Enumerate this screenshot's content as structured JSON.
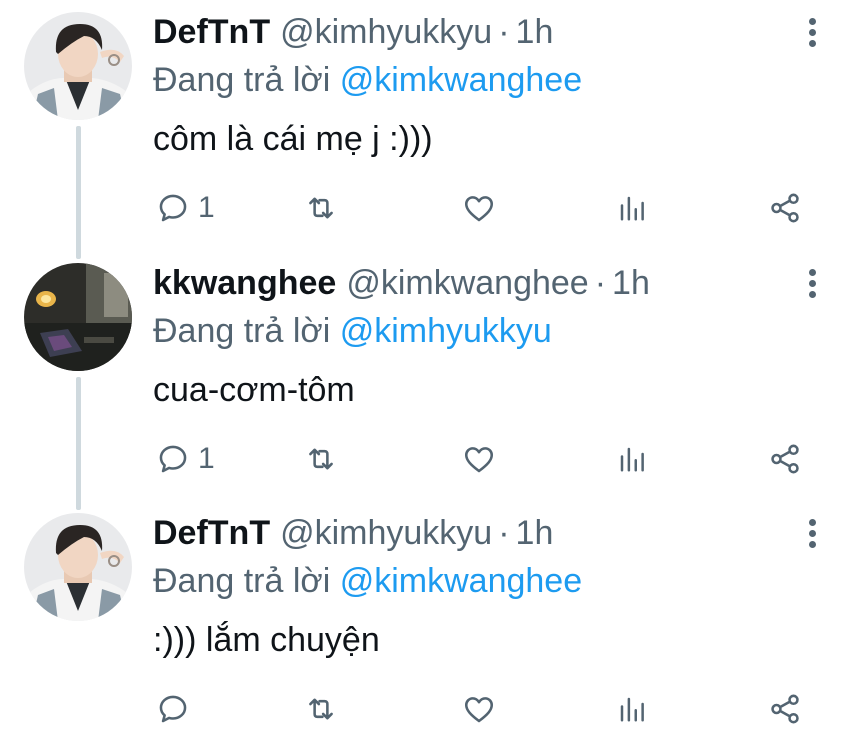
{
  "tweets": [
    {
      "name": "DefTnT",
      "handle": "@kimhyukkyu",
      "separator": "·",
      "time": "1h",
      "reply_prefix": "Đang trả lời",
      "reply_to": "@kimkwanghee",
      "text": "côm là cái mẹ j :)))",
      "reply_count": "1",
      "avatar": "boy-avatar"
    },
    {
      "name": "kkwanghee",
      "handle": "@kimkwanghee",
      "separator": "·",
      "time": "1h",
      "reply_prefix": "Đang trả lời",
      "reply_to": "@kimhyukkyu",
      "text": "cua-cơm-tôm",
      "reply_count": "1",
      "avatar": "dark-room-avatar"
    },
    {
      "name": "DefTnT",
      "handle": "@kimhyukkyu",
      "separator": "·",
      "time": "1h",
      "reply_prefix": "Đang trả lời",
      "reply_to": "@kimkwanghee",
      "text": ":))) lắm chuyện",
      "reply_count": "",
      "avatar": "boy-avatar"
    }
  ],
  "icons": {
    "reply": "reply-icon",
    "retweet": "retweet-icon",
    "like": "heart-icon",
    "views": "views-icon",
    "share": "share-icon",
    "more": "more-vertical-icon"
  },
  "colors": {
    "text": "#0f1419",
    "secondary": "#536471",
    "link": "#1d9bf0",
    "thread_line": "#cfd9de"
  }
}
